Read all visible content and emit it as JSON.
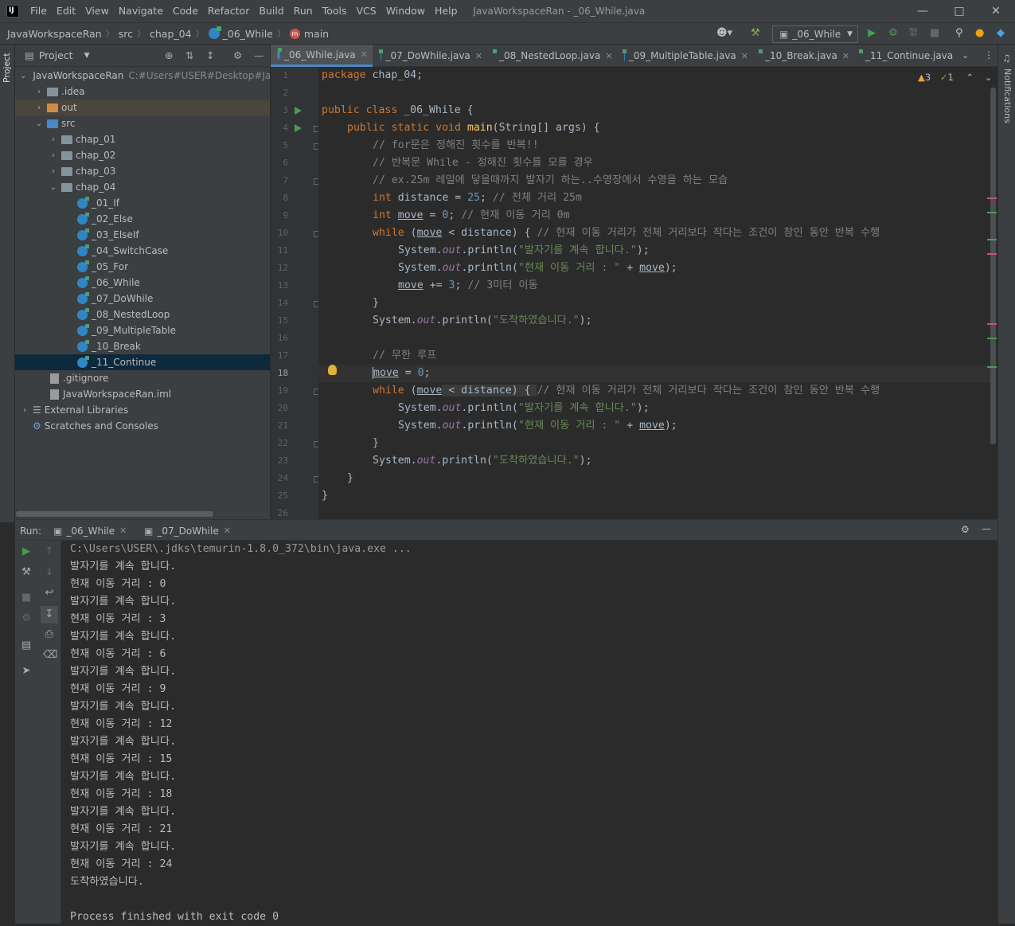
{
  "menu": [
    "File",
    "Edit",
    "View",
    "Navigate",
    "Code",
    "Refactor",
    "Build",
    "Run",
    "Tools",
    "VCS",
    "Window",
    "Help"
  ],
  "window_title": "JavaWorkspaceRan - _06_While.java",
  "breadcrumb": {
    "project": "JavaWorkspaceRan",
    "src": "src",
    "package": "chap_04",
    "class": "_06_While",
    "method": "main"
  },
  "run_config": "_06_While",
  "project_panel": {
    "title": "Project",
    "tree": [
      {
        "label": "JavaWorkspaceRan",
        "path": "C:#Users#USER#Desktop#Ja"
      },
      {
        "label": ".idea"
      },
      {
        "label": "out"
      },
      {
        "label": "src"
      },
      {
        "label": "chap_01"
      },
      {
        "label": "chap_02"
      },
      {
        "label": "chap_03"
      },
      {
        "label": "chap_04"
      },
      {
        "label": "_01_If"
      },
      {
        "label": "_02_Else"
      },
      {
        "label": "_03_ElseIf"
      },
      {
        "label": "_04_SwitchCase"
      },
      {
        "label": "_05_For"
      },
      {
        "label": "_06_While"
      },
      {
        "label": "_07_DoWhile"
      },
      {
        "label": "_08_NestedLoop"
      },
      {
        "label": "_09_MultipleTable"
      },
      {
        "label": "_10_Break"
      },
      {
        "label": "_11_Continue"
      },
      {
        "label": ".gitignore"
      },
      {
        "label": "JavaWorkspaceRan.iml"
      },
      {
        "label": "External Libraries"
      },
      {
        "label": "Scratches and Consoles"
      }
    ]
  },
  "editor_tabs": [
    "_06_While.java",
    "_07_DoWhile.java",
    "_08_NestedLoop.java",
    "_09_MultipleTable.java",
    "_10_Break.java",
    "_11_Continue.java"
  ],
  "inspections": {
    "warnings": "3",
    "weak": "1"
  },
  "line_numbers": [
    "1",
    "2",
    "3",
    "4",
    "5",
    "6",
    "7",
    "8",
    "9",
    "10",
    "11",
    "12",
    "13",
    "14",
    "15",
    "16",
    "17",
    "18",
    "19",
    "20",
    "21",
    "22",
    "23",
    "24",
    "25",
    "26"
  ],
  "code": {
    "l1_kw": "package",
    "l1_rest": " chap_04;",
    "l3_kw": "public class",
    "l3_rest": " _06_While {",
    "l4_kw": "public static void",
    "l4_fn": "main",
    "l4_rest": "(String[] args) {",
    "l5": "// for문은 정해진 횟수를 반복!!",
    "l6": "// 반복문 While - 정해진 횟수를 모를 경우",
    "l7": "// ex.25m 레일에 닿을때까지 발자기 하는..수영장에서 수영을 하는 모습",
    "l8_kw": "int",
    "l8_a": " distance = ",
    "l8_num": "25",
    "l8_b": "; ",
    "l8_cm": "// 전체 거리 25m",
    "l9_kw": "int",
    "l9_var": "move",
    "l9_a": " = ",
    "l9_num": "0",
    "l9_b": "; ",
    "l9_cm": "// 현재 이동 거리 0m",
    "l10_kw": "while",
    "l10_a": " (",
    "l10_var": "move",
    "l10_b": " < distance) { ",
    "l10_cm": "// 현재 이동 거리가 전체 거리보다 작다는 조건이 참인 동안 반복 수행",
    "l11_a": "System.",
    "l11_it": "out",
    "l11_b": ".println(",
    "l11_str": "\"발자기를 계속 합니다.\"",
    "l11_c": ");",
    "l12_a": "System.",
    "l12_it": "out",
    "l12_b": ".println(",
    "l12_str": "\"현재 이동 거리 : \"",
    "l12_c": " + ",
    "l12_var": "move",
    "l12_d": ");",
    "l13_var": "move",
    "l13_a": " += ",
    "l13_num": "3",
    "l13_b": "; ",
    "l13_cm": "// 3미터 이동",
    "l14": "}",
    "l15_a": "System.",
    "l15_it": "out",
    "l15_b": ".println(",
    "l15_str": "\"도착하였습니다.\"",
    "l15_c": ");",
    "l17": "// 무한 루프",
    "l18_var": "move",
    "l18_a": " = ",
    "l18_num": "0",
    "l18_b": ";",
    "l19_kw": "while",
    "l19_a": " (",
    "l19_var": "move",
    "l19_b": " < distance) { ",
    "l19_cm": "// 현재 이동 거리가 전체 거리보다 작다는 조건이 참인 동안 반복 수행",
    "l20_a": "System.",
    "l20_it": "out",
    "l20_b": ".println(",
    "l20_str": "\"발자기를 계속 합니다.\"",
    "l20_c": ");",
    "l21_a": "System.",
    "l21_it": "out",
    "l21_b": ".println(",
    "l21_str": "\"현재 이동 거리 : \"",
    "l21_c": " + ",
    "l21_var": "move",
    "l21_d": ");",
    "l22": "}",
    "l23_a": "System.",
    "l23_it": "out",
    "l23_b": ".println(",
    "l23_str": "\"도착하였습니다.\"",
    "l23_c": ");",
    "l24": "}",
    "l25": "}"
  },
  "run_panel": {
    "label": "Run:",
    "tabs": [
      "_06_While",
      "_07_DoWhile"
    ],
    "console": [
      "C:\\Users\\USER\\.jdks\\temurin-1.8.0_372\\bin\\java.exe ...",
      "발자기를 계속 합니다.",
      "현재 이동 거리 : 0",
      "발자기를 계속 합니다.",
      "현재 이동 거리 : 3",
      "발자기를 계속 합니다.",
      "현재 이동 거리 : 6",
      "발자기를 계속 합니다.",
      "현재 이동 거리 : 9",
      "발자기를 계속 합니다.",
      "현재 이동 거리 : 12",
      "발자기를 계속 합니다.",
      "현재 이동 거리 : 15",
      "발자기를 계속 합니다.",
      "현재 이동 거리 : 18",
      "발자기를 계속 합니다.",
      "현재 이동 거리 : 21",
      "발자기를 계속 합니다.",
      "현재 이동 거리 : 24",
      "도착하였습니다.",
      "",
      "Process finished with exit code 0"
    ]
  },
  "side_labels": {
    "project": "Project",
    "notifications": "Notifications"
  }
}
